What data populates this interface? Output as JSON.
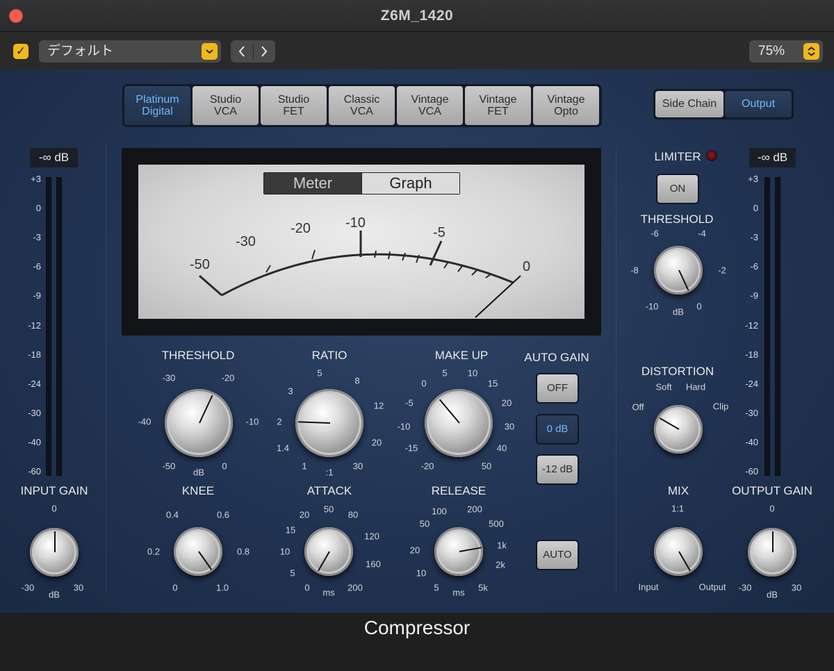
{
  "window": {
    "title": "Z6M_1420",
    "close_color": "#ec5f57"
  },
  "preset_bar": {
    "enabled": true,
    "preset_name": "デフォルト",
    "prev_icon": "chevron-left-icon",
    "next_icon": "chevron-right-icon",
    "zoom": "75%"
  },
  "models": [
    {
      "label": "Platinum\nDigital",
      "selected": true
    },
    {
      "label": "Studio\nVCA",
      "selected": false
    },
    {
      "label": "Studio\nFET",
      "selected": false
    },
    {
      "label": "Classic\nVCA",
      "selected": false
    },
    {
      "label": "Vintage\nVCA",
      "selected": false
    },
    {
      "label": "Vintage\nFET",
      "selected": false
    },
    {
      "label": "Vintage\nOpto",
      "selected": false
    }
  ],
  "routing": {
    "side_chain": "Side Chain",
    "output": "Output",
    "selected": "Output"
  },
  "meter": {
    "tabs": [
      "Meter",
      "Graph"
    ],
    "selected_tab": "Meter",
    "scale": [
      "-50",
      "-30",
      "-20",
      "-10",
      "-5",
      "0"
    ]
  },
  "input": {
    "readout": "-∞ dB",
    "scale": [
      "+3",
      "0",
      "-3",
      "-6",
      "-9",
      "-12",
      "-18",
      "-24",
      "-30",
      "-40",
      "-60"
    ],
    "gain_label": "INPUT GAIN",
    "gain_ticks": {
      "top": "0",
      "min": "-30",
      "max": "30",
      "unit": "dB"
    },
    "gain_value": 0
  },
  "output": {
    "readout": "-∞ dB",
    "scale": [
      "+3",
      "0",
      "-3",
      "-6",
      "-9",
      "-12",
      "-18",
      "-24",
      "-30",
      "-40",
      "-60"
    ],
    "gain_label": "OUTPUT GAIN",
    "gain_ticks": {
      "top": "0",
      "min": "-30",
      "max": "30",
      "unit": "dB"
    },
    "gain_value": 0
  },
  "knobs": {
    "threshold": {
      "label": "THRESHOLD",
      "ticks": [
        "-50",
        "-40",
        "-30",
        "-20",
        "-10",
        "0"
      ],
      "unit": "dB"
    },
    "ratio": {
      "label": "RATIO",
      "ticks": [
        "1",
        "1.4",
        "2",
        "3",
        "5",
        "8",
        "12",
        "20",
        "30"
      ],
      "unit": ":1",
      "value": "2"
    },
    "makeup": {
      "label": "MAKE UP",
      "ticks": [
        "-20",
        "-15",
        "-10",
        "-5",
        "0",
        "5",
        "10",
        "15",
        "20",
        "30",
        "40",
        "50"
      ]
    },
    "knee": {
      "label": "KNEE",
      "ticks": [
        "0",
        "0.2",
        "0.4",
        "0.6",
        "0.8",
        "1.0"
      ]
    },
    "attack": {
      "label": "ATTACK",
      "ticks": [
        "0",
        "5",
        "10",
        "15",
        "20",
        "50",
        "80",
        "120",
        "160",
        "200"
      ],
      "unit": "ms"
    },
    "release": {
      "label": "RELEASE",
      "ticks": [
        "5",
        "10",
        "20",
        "50",
        "100",
        "200",
        "500",
        "1k",
        "2k",
        "5k"
      ],
      "unit": "ms"
    }
  },
  "auto_gain": {
    "label": "AUTO GAIN",
    "off": "OFF",
    "zero": "0 dB",
    "minus12": "-12 dB",
    "selected": "0 dB"
  },
  "auto_button": "AUTO",
  "limiter": {
    "label": "LIMITER",
    "on_label": "ON",
    "threshold_label": "THRESHOLD",
    "threshold_ticks": [
      "-10",
      "-8",
      "-6",
      "-4",
      "-2",
      "0"
    ],
    "unit": "dB"
  },
  "distortion": {
    "label": "DISTORTION",
    "ticks": [
      "Off",
      "Soft",
      "Hard",
      "Clip"
    ],
    "selected": "Off"
  },
  "mix": {
    "label": "MIX",
    "ticks": {
      "top": "1:1",
      "left": "Input",
      "right": "Output"
    }
  },
  "footer": {
    "title": "Compressor"
  }
}
